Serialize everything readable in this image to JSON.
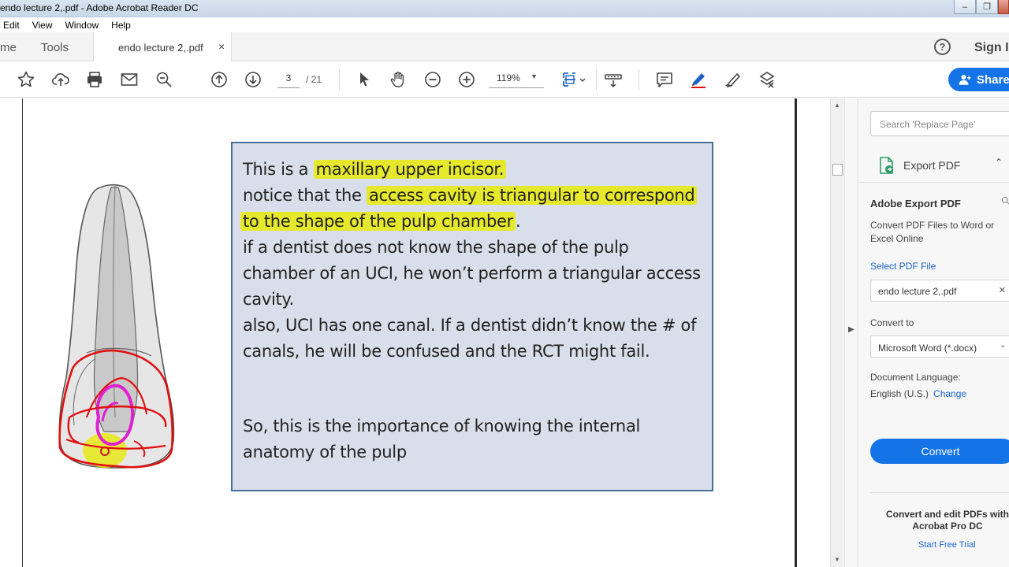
{
  "window": {
    "title": "endo lecture 2,.pdf - Adobe Acrobat Reader DC",
    "restore_glyph": "❐",
    "minimize_glyph": "–"
  },
  "menu": [
    "Edit",
    "View",
    "Window",
    "Help"
  ],
  "tabs": {
    "home": "me",
    "tools": "Tools",
    "document": "endo lecture 2,.pdf",
    "close_glyph": "×"
  },
  "header": {
    "help_glyph": "?",
    "sign_in": "Sign I",
    "share": "Share"
  },
  "toolbar": {
    "page_current": "3",
    "page_total": "/ 21",
    "zoom": "119%",
    "zoom_caret": "▼"
  },
  "slide": {
    "line1_pre": "This is a",
    "line1_hl": "maxillary upper incisor.",
    "line2_pre": "notice that the",
    "line2_hl": "access cavity is triangular to correspond",
    "line3_hl": "to the shape of the pulp chamber",
    "line3_post": ".",
    "line4": "if a dentist does not know the shape of the pulp",
    "line5": "chamber of an UCI, he won’t perform a triangular access",
    "line6": "cavity.",
    "line7": "also, UCI has one canal. If a dentist didn’t know the # of",
    "line8": "canals, he will be confused and the RCT might fail.",
    "line9": "So, this is the importance of knowing the internal",
    "line10": "anatomy of the pulp"
  },
  "scrollbar": {
    "up": "▲",
    "down": "▼"
  },
  "panel_toggle": "▶",
  "right_pane": {
    "search_placeholder": "Search 'Replace Page'",
    "export_heading": "Export PDF",
    "collapse_glyph": "⌃",
    "tool_title": "Adobe Export PDF",
    "description": "Convert PDF Files to Word or Excel Online",
    "select_link": "Select PDF File",
    "file_name": "endo lecture 2,.pdf",
    "file_clear_glyph": "×",
    "convert_to_label": "Convert to",
    "format": "Microsoft Word (*.docx)",
    "format_caret": "⌄",
    "language_label": "Document Language:",
    "language": "English (U.S.)",
    "change": "Change",
    "convert_button": "Convert",
    "promo": "Convert and edit PDFs with Acrobat Pro DC",
    "trial_link": "Start Free Trial"
  },
  "colors": {
    "accent_blue": "#1473e6",
    "highlight_yellow": "#e6e82c",
    "slide_background": "#d9dfea",
    "slide_border": "#4a6e9a",
    "annotation_red": "#e01010",
    "annotation_magenta": "#e020d0"
  }
}
